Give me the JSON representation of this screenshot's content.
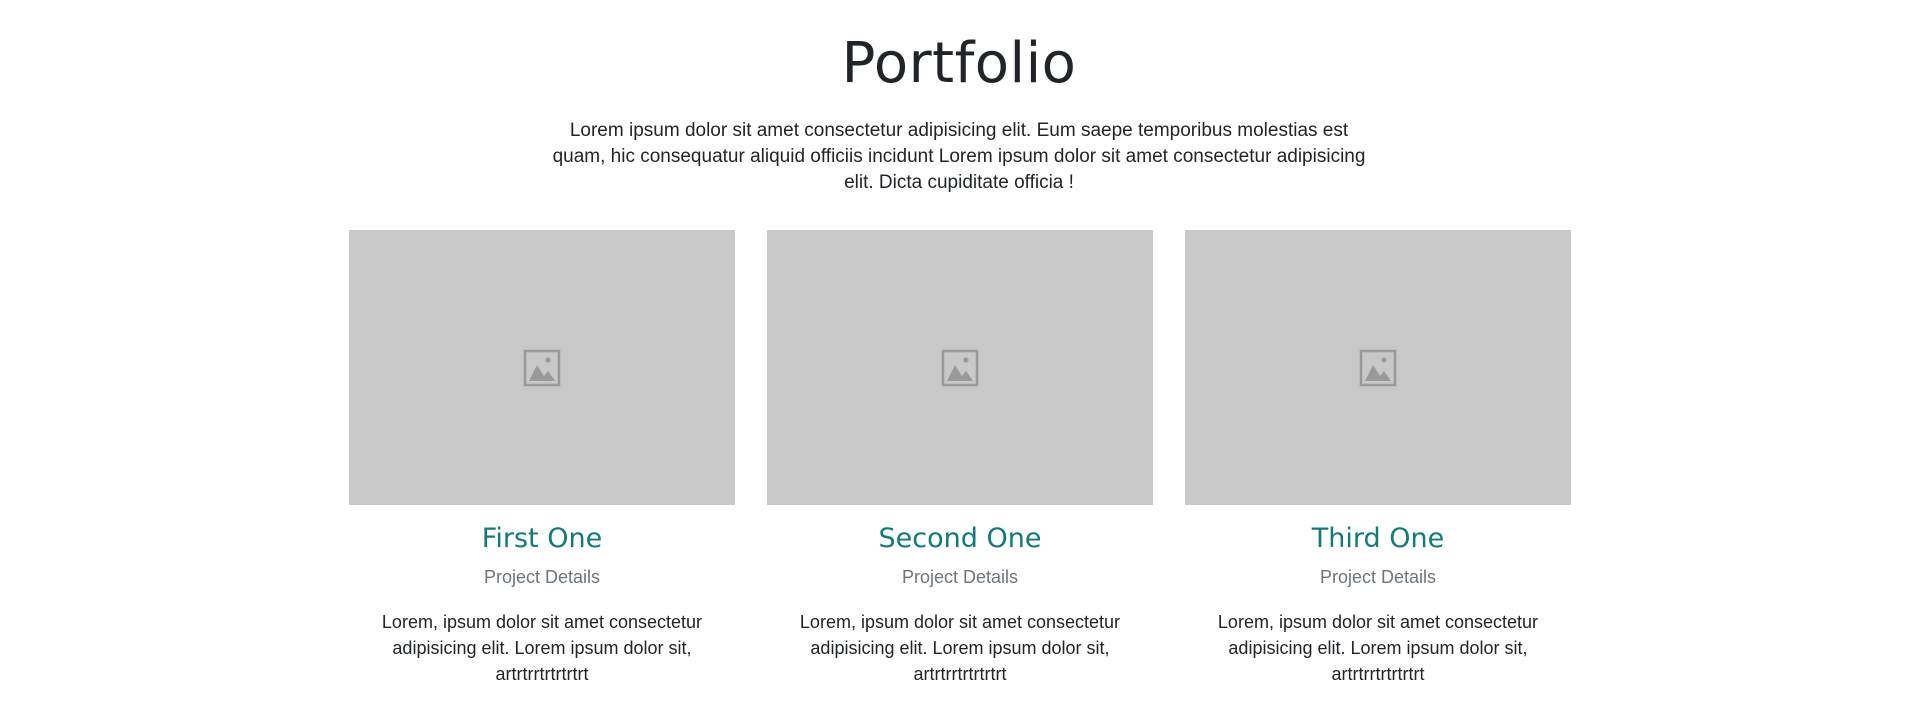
{
  "section": {
    "title": "Portfolio",
    "intro": "Lorem ipsum dolor sit amet consectetur adipisicing elit. Eum saepe temporibus molestias est quam, hic consequatur aliquid officiis incidunt Lorem ipsum dolor sit amet consectetur adipisicing elit. Dicta cupiditate officia !"
  },
  "colors": {
    "card_title": "#117a7a",
    "subtitle": "#6c757d",
    "placeholder_bg": "#c8c8c8",
    "placeholder_icon": "#999999"
  },
  "cards": [
    {
      "title": "First One",
      "subtitle": "Project Details",
      "text": "Lorem, ipsum dolor sit amet consectetur adipisicing elit. Lorem ipsum dolor sit, artrtrrtrtrtrtrt",
      "icon": "image-placeholder-icon"
    },
    {
      "title": "Second One",
      "subtitle": "Project Details",
      "text": "Lorem, ipsum dolor sit amet consectetur adipisicing elit. Lorem ipsum dolor sit, artrtrrtrtrtrtrt",
      "icon": "image-placeholder-icon"
    },
    {
      "title": "Third One",
      "subtitle": "Project Details",
      "text": "Lorem, ipsum dolor sit amet consectetur adipisicing elit. Lorem ipsum dolor sit, artrtrrtrtrtrtrt",
      "icon": "image-placeholder-icon"
    }
  ]
}
